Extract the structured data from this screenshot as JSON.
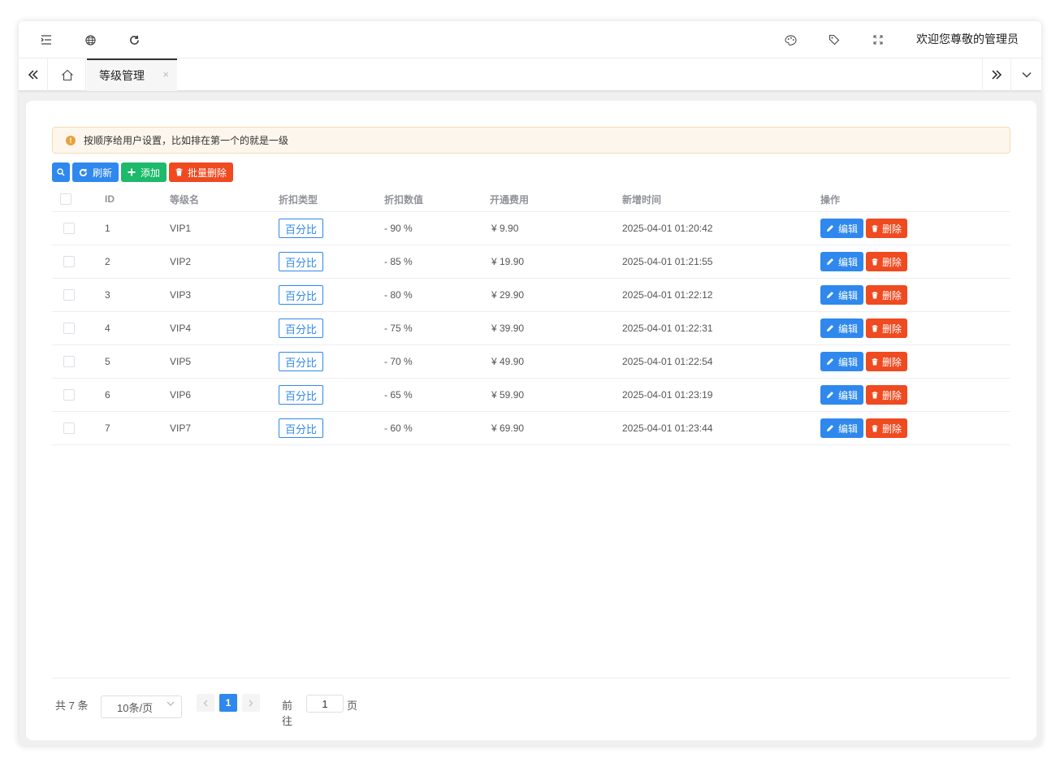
{
  "header": {
    "welcome": "欢迎您尊敬的管理员",
    "icons": [
      "menu-fold-icon",
      "globe-icon",
      "refresh-icon",
      "palette-icon",
      "tag-icon",
      "fullscreen-icon"
    ]
  },
  "tabs": {
    "active_label": "等级管理",
    "close": "×"
  },
  "alert": {
    "icon": "!",
    "text": "按顺序给用户设置，比如排在第一个的就是一级"
  },
  "toolbar": {
    "refresh": "刷新",
    "add": "添加",
    "batch_delete": "批量删除"
  },
  "table": {
    "columns": [
      "ID",
      "等级名",
      "折扣类型",
      "折扣数值",
      "开通费用",
      "新增时间",
      "操作"
    ],
    "rows": [
      {
        "id": "1",
        "name": "VIP1",
        "type": "百分比",
        "discount": "- 90 %",
        "fee": "¥ 9.90",
        "time": "2025-04-01 01:20:42"
      },
      {
        "id": "2",
        "name": "VIP2",
        "type": "百分比",
        "discount": "- 85 %",
        "fee": "¥ 19.90",
        "time": "2025-04-01 01:21:55"
      },
      {
        "id": "3",
        "name": "VIP3",
        "type": "百分比",
        "discount": "- 80 %",
        "fee": "¥ 29.90",
        "time": "2025-04-01 01:22:12"
      },
      {
        "id": "4",
        "name": "VIP4",
        "type": "百分比",
        "discount": "- 75 %",
        "fee": "¥ 39.90",
        "time": "2025-04-01 01:22:31"
      },
      {
        "id": "5",
        "name": "VIP5",
        "type": "百分比",
        "discount": "- 70 %",
        "fee": "¥ 49.90",
        "time": "2025-04-01 01:22:54"
      },
      {
        "id": "6",
        "name": "VIP6",
        "type": "百分比",
        "discount": "- 65 %",
        "fee": "¥ 59.90",
        "time": "2025-04-01 01:23:19"
      },
      {
        "id": "7",
        "name": "VIP7",
        "type": "百分比",
        "discount": "- 60 %",
        "fee": "¥ 69.90",
        "time": "2025-04-01 01:23:44"
      }
    ],
    "edit_label": "编辑",
    "delete_label": "删除"
  },
  "pagination": {
    "total": "共 7 条",
    "page_size": "10条/页",
    "current_page": "1",
    "goto_prefix": "前往",
    "goto_value": "1",
    "goto_suffix": "页"
  },
  "colors": {
    "primary": "#2f88ed",
    "success": "#1cba6a",
    "danger": "#ef4a20",
    "warning": "#e6a23c"
  }
}
